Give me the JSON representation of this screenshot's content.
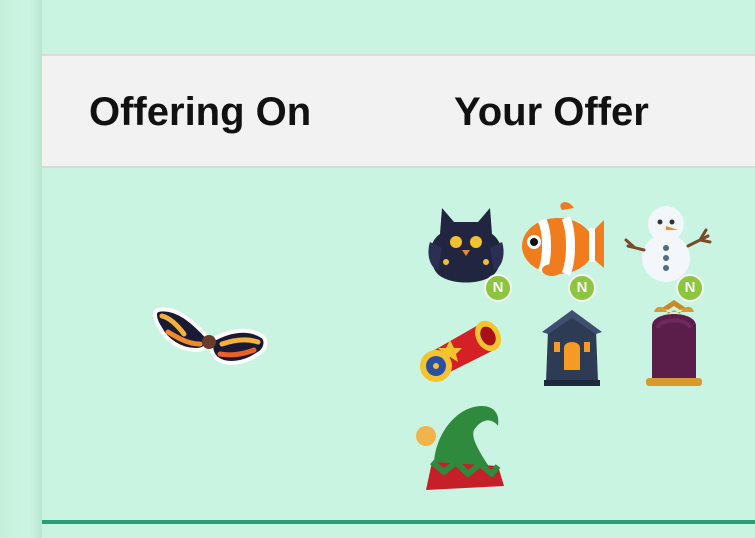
{
  "trade": {
    "offering_on_label": "Offering On",
    "your_offer_label": "Your Offer"
  },
  "offering_on_items": [
    {
      "icon": "flame-wings-icon"
    }
  ],
  "your_offer_items": [
    {
      "icon": "shadow-owl-pet-icon",
      "badge": "N"
    },
    {
      "icon": "clownfish-pet-icon",
      "badge": "N"
    },
    {
      "icon": "snowman-pet-icon",
      "badge": "N"
    },
    {
      "icon": "circus-cannon-icon"
    },
    {
      "icon": "haunted-house-icon"
    },
    {
      "icon": "bat-gravestone-icon"
    },
    {
      "icon": "elf-hat-icon"
    }
  ],
  "colors": {
    "background": "#c9f4e1",
    "header_bar": "#f2f2f2",
    "badge": "#8cc63f",
    "bottom_line": "#2a9d78"
  }
}
